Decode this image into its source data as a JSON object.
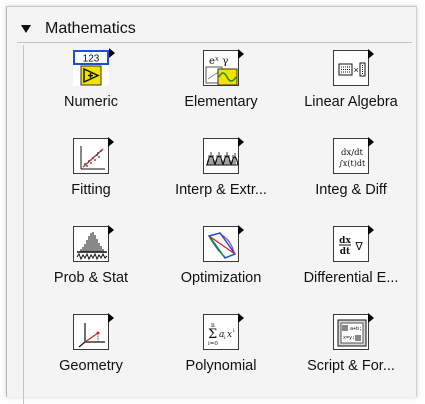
{
  "palette": {
    "title": "Mathematics",
    "items": [
      {
        "label": "Numeric",
        "icon": "numeric-icon",
        "badge": "123"
      },
      {
        "label": "Elementary",
        "icon": "elementary-icon",
        "formula": "eˣ γ"
      },
      {
        "label": "Linear Algebra",
        "icon": "linear-algebra-icon"
      },
      {
        "label": "Fitting",
        "icon": "fitting-icon"
      },
      {
        "label": "Interp & Extr...",
        "icon": "interp-extr-icon"
      },
      {
        "label": "Integ & Diff",
        "icon": "integ-diff-icon",
        "formula_top": "dx/dt",
        "formula_bottom": "∫x(t)dt"
      },
      {
        "label": "Prob & Stat",
        "icon": "prob-stat-icon"
      },
      {
        "label": "Optimization",
        "icon": "optimization-icon"
      },
      {
        "label": "Differential E...",
        "icon": "differential-eq-icon"
      },
      {
        "label": "Geometry",
        "icon": "geometry-icon"
      },
      {
        "label": "Polynomial",
        "icon": "polynomial-icon"
      },
      {
        "label": "Script & For...",
        "icon": "script-formula-icon"
      }
    ]
  },
  "colors": {
    "accent_blue": "#1b4fd6",
    "accent_red": "#d62020",
    "accent_green": "#1a8f2a",
    "accent_yellow": "#f3e100"
  }
}
